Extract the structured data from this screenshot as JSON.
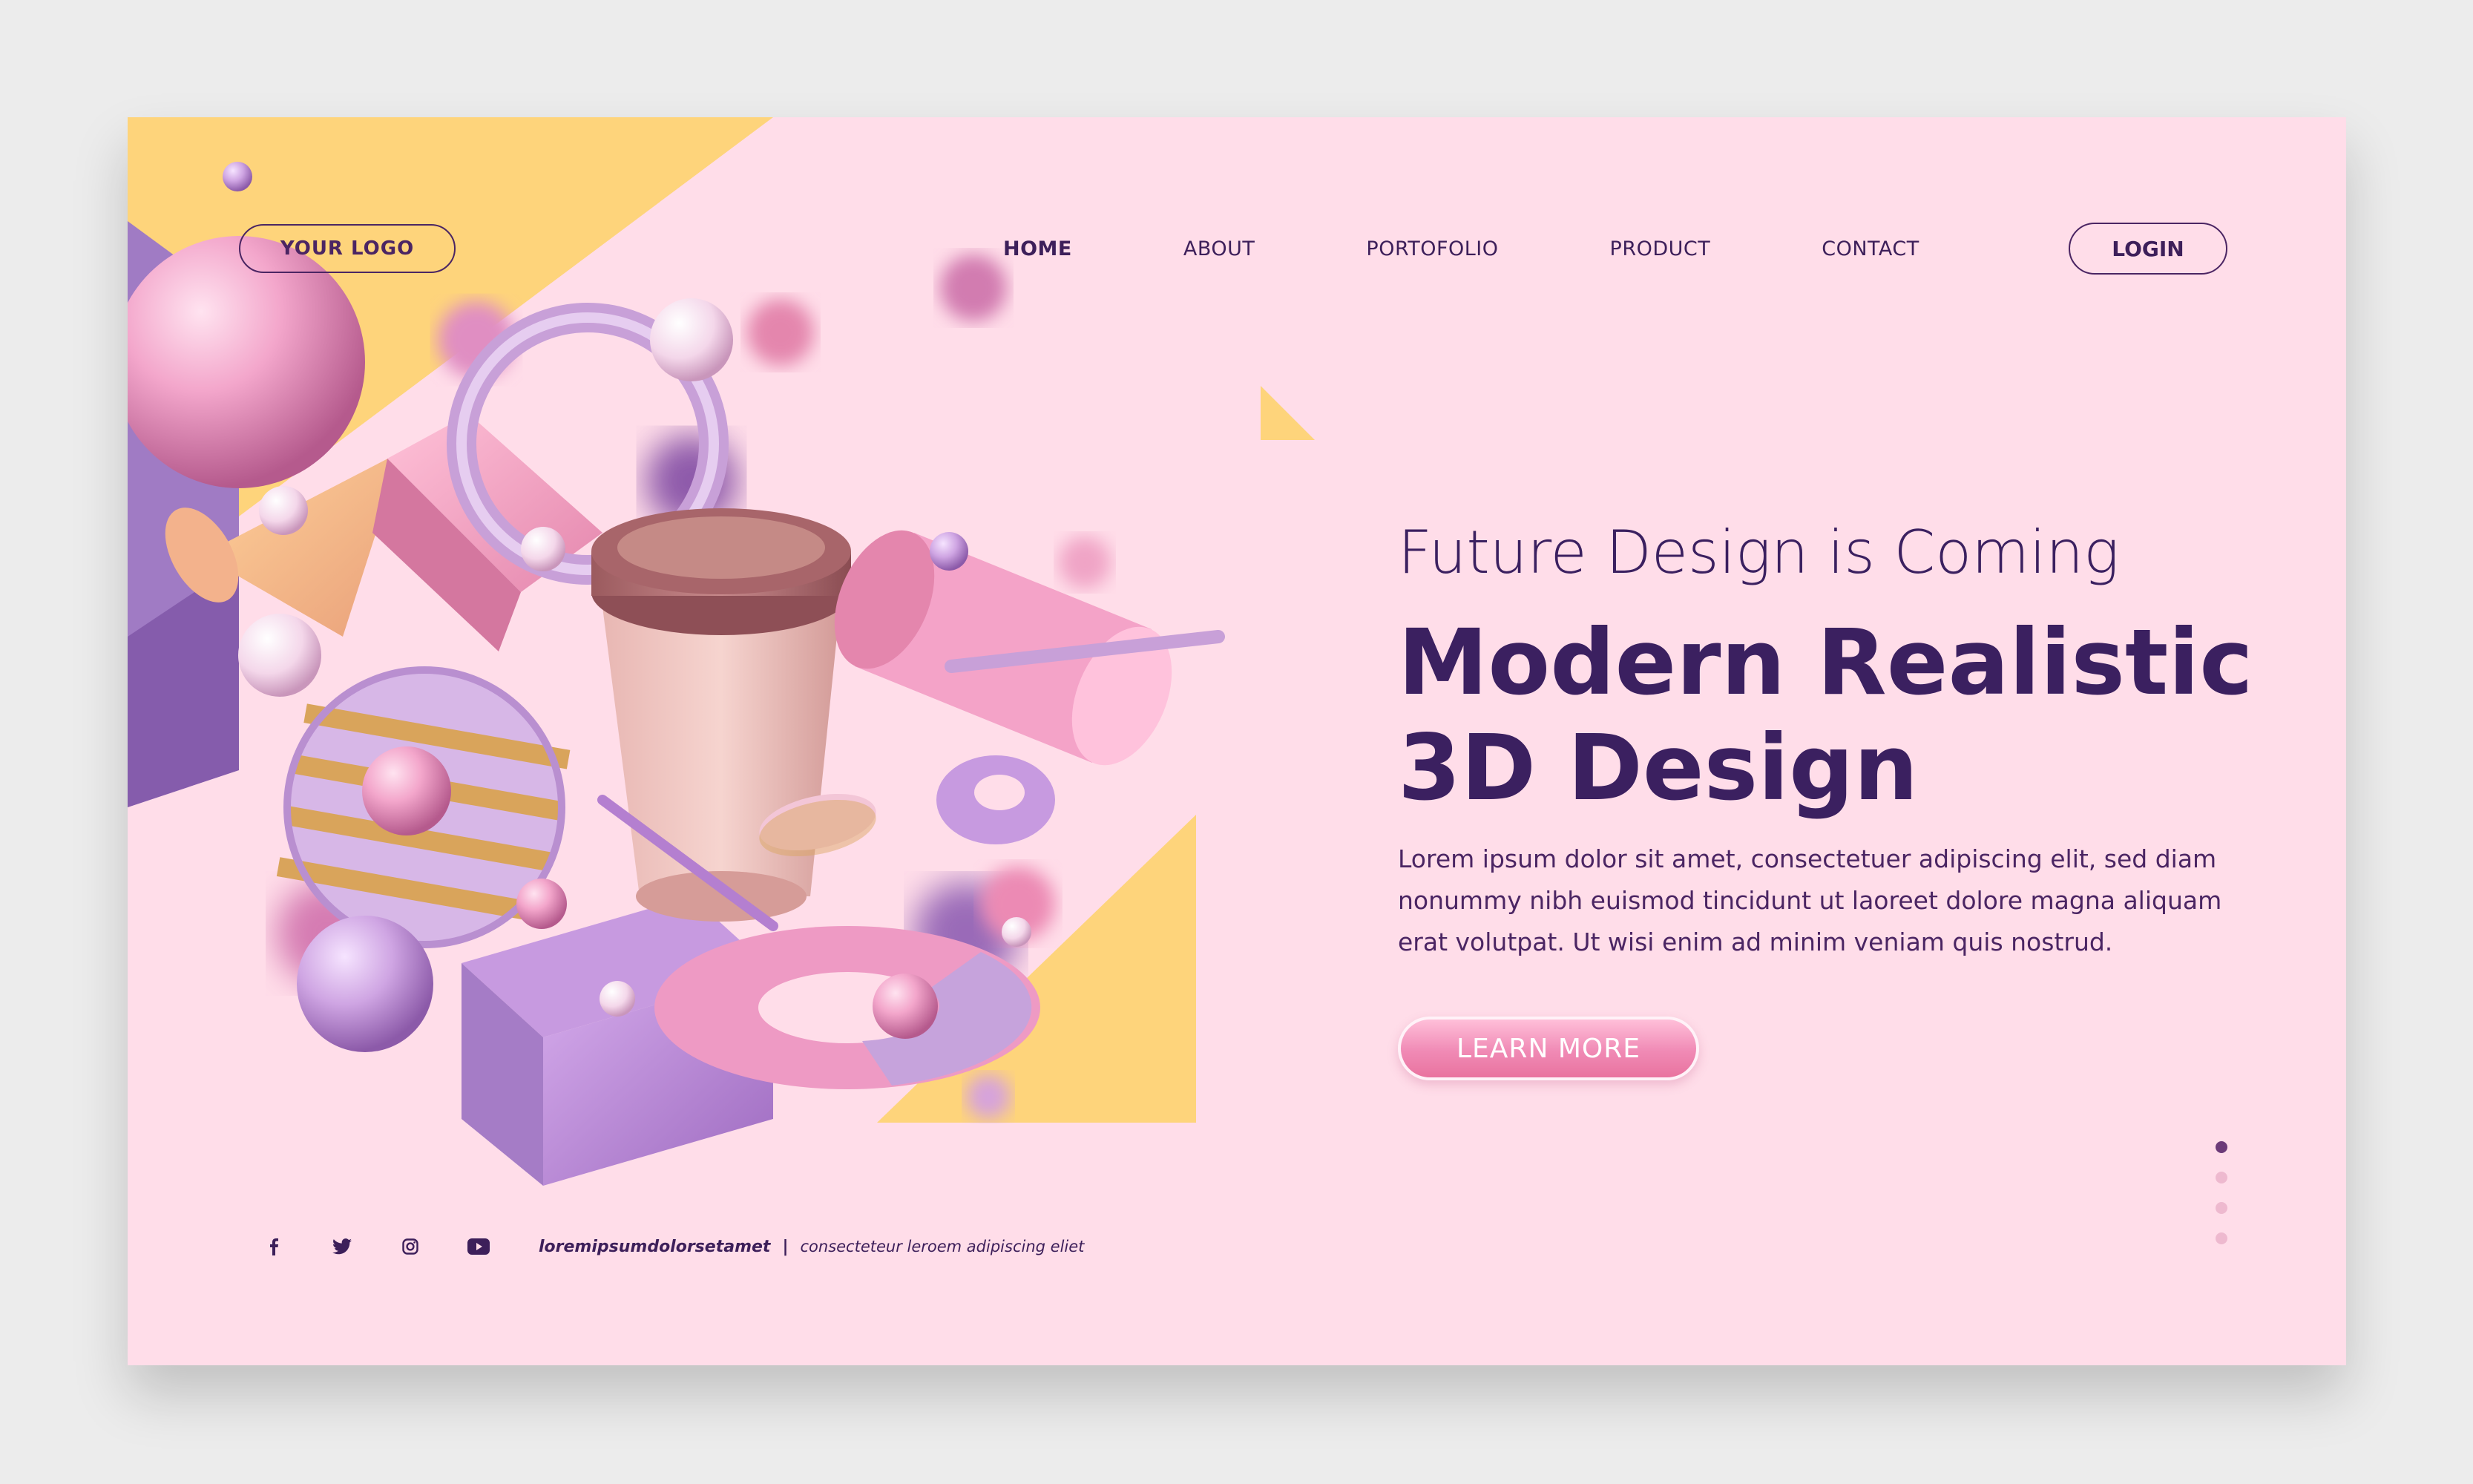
{
  "header": {
    "logo_label": "YOUR LOGO",
    "nav": [
      {
        "label": "HOME",
        "active": true
      },
      {
        "label": "ABOUT",
        "active": false
      },
      {
        "label": "PORTOFOLIO",
        "active": false
      },
      {
        "label": "PRODUCT",
        "active": false
      },
      {
        "label": "CONTACT",
        "active": false
      }
    ],
    "login_label": "LOGIN"
  },
  "hero": {
    "subtitle": "Future Design is Coming",
    "title_line1": "Modern Realistic",
    "title_line2": "3D Design",
    "description": "Lorem ipsum dolor sit amet, consectetuer adipiscing elit, sed diam nonummy nibh euismod tincidunt ut laoreet dolore magna aliquam erat volutpat. Ut wisi enim ad minim veniam quis nostrud.",
    "cta_label": "LEARN MORE"
  },
  "pagination": {
    "count": 4,
    "active_index": 0
  },
  "footer": {
    "social_icons": [
      "facebook-icon",
      "twitter-icon",
      "instagram-icon",
      "youtube-icon"
    ],
    "text_bold": "loremipsumdolorsetamet",
    "separator": "|",
    "text_light": "consecteteur leroem adipiscing eliet"
  },
  "colors": {
    "background": "#ffdde9",
    "accent_yellow": "#fed47b",
    "text_dark": "#3b2060",
    "button_pink": "#f08ab5",
    "page_outer": "#ececec"
  }
}
